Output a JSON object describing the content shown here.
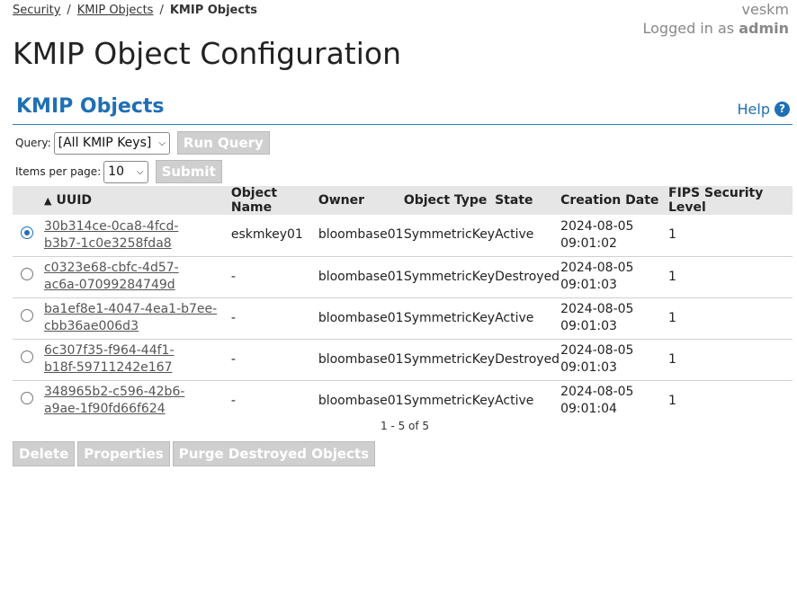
{
  "breadcrumb": {
    "items": [
      "Security",
      "KMIP Objects"
    ],
    "current": "KMIP Objects",
    "separator": "/"
  },
  "user": {
    "name": "veskm",
    "login_prefix": "Logged in as ",
    "login_user": "admin"
  },
  "page_title": "KMIP Object Configuration",
  "section": {
    "title": "KMIP Objects",
    "help_label": "Help",
    "help_icon": "?"
  },
  "query": {
    "label": "Query:",
    "value": "[All KMIP Keys]",
    "run_label": "Run Query"
  },
  "paging": {
    "label": "Items per page:",
    "value": "10",
    "submit_label": "Submit",
    "summary": "1 - 5 of 5"
  },
  "table": {
    "columns": [
      "UUID",
      "Object Name",
      "Owner",
      "Object Type",
      "State",
      "Creation Date",
      "FIPS Security Level"
    ],
    "sort_indicator": "▲",
    "rows": [
      {
        "selected": true,
        "uuid1": "30b314ce-0ca8-4fcd-",
        "uuid2": "b3b7-1c0e3258fda8",
        "name": "eskmkey01",
        "owner": "bloombase01",
        "type": "SymmetricKey",
        "state": "Active",
        "date1": "2024-08-05",
        "date2": "09:01:02",
        "fips": "1"
      },
      {
        "selected": false,
        "uuid1": "c0323e68-cbfc-4d57-",
        "uuid2": "ac6a-07099284749d",
        "name": "-",
        "owner": "bloombase01",
        "type": "SymmetricKey",
        "state": "Destroyed",
        "date1": "2024-08-05",
        "date2": "09:01:03",
        "fips": "1"
      },
      {
        "selected": false,
        "uuid1": "ba1ef8e1-4047-4ea1-b7ee-",
        "uuid2": "cbb36ae006d3",
        "name": "-",
        "owner": "bloombase01",
        "type": "SymmetricKey",
        "state": "Active",
        "date1": "2024-08-05",
        "date2": "09:01:03",
        "fips": "1"
      },
      {
        "selected": false,
        "uuid1": "6c307f35-f964-44f1-",
        "uuid2": "b18f-59711242e167",
        "name": "-",
        "owner": "bloombase01",
        "type": "SymmetricKey",
        "state": "Destroyed",
        "date1": "2024-08-05",
        "date2": "09:01:03",
        "fips": "1"
      },
      {
        "selected": false,
        "uuid1": "348965b2-c596-42b6-",
        "uuid2": "a9ae-1f90fd66f624",
        "name": "-",
        "owner": "bloombase01",
        "type": "SymmetricKey",
        "state": "Active",
        "date1": "2024-08-05",
        "date2": "09:01:04",
        "fips": "1"
      }
    ]
  },
  "actions": {
    "delete": "Delete",
    "properties": "Properties",
    "purge": "Purge Destroyed Objects"
  },
  "colors": {
    "accent": "#1f6fb5",
    "disabled_button": "#cfcfcf",
    "header_bg": "#e6e6e6"
  }
}
